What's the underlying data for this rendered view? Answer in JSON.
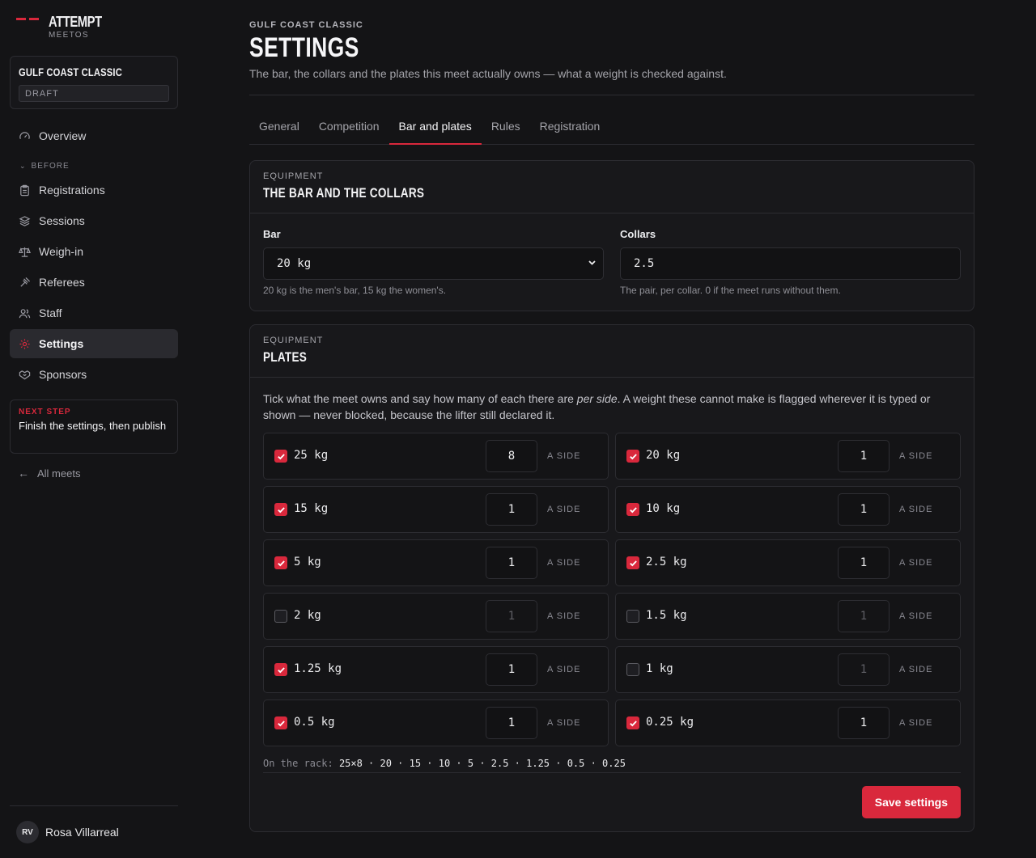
{
  "brand": {
    "name": "ATTEMPT",
    "sub": "MEETOS",
    "accent": "#d9283c"
  },
  "meet_card": {
    "title": "GULF COAST CLASSIC",
    "status": "DRAFT"
  },
  "nav": {
    "overview": "Overview",
    "section_before": "BEFORE",
    "items": [
      {
        "label": "Registrations",
        "icon": "clipboard-icon"
      },
      {
        "label": "Sessions",
        "icon": "layers-icon"
      },
      {
        "label": "Weigh-in",
        "icon": "scale-icon"
      },
      {
        "label": "Referees",
        "icon": "gavel-icon"
      },
      {
        "label": "Staff",
        "icon": "users-icon"
      },
      {
        "label": "Settings",
        "icon": "gear-icon",
        "active": true
      },
      {
        "label": "Sponsors",
        "icon": "handshake-icon"
      }
    ]
  },
  "next_step": {
    "label": "NEXT STEP",
    "text": "Finish the settings, then publish"
  },
  "all_meets": "All meets",
  "user": {
    "initials": "RV",
    "name": "Rosa Villarreal"
  },
  "header": {
    "crumb": "GULF COAST CLASSIC",
    "title": "SETTINGS",
    "description": "The bar, the collars and the plates this meet actually owns — what a weight is checked against."
  },
  "tabs": [
    {
      "label": "General"
    },
    {
      "label": "Competition"
    },
    {
      "label": "Bar and plates",
      "active": true
    },
    {
      "label": "Rules"
    },
    {
      "label": "Registration"
    }
  ],
  "bar_card": {
    "eyebrow": "EQUIPMENT",
    "title": "THE BAR AND THE COLLARS",
    "bar_label": "Bar",
    "bar_value": "20 kg",
    "bar_hint": "20 kg is the men's bar, 15 kg the women's.",
    "collars_label": "Collars",
    "collars_value": "2.5",
    "collars_hint": "The pair, per collar. 0 if the meet runs without them."
  },
  "plates_card": {
    "eyebrow": "EQUIPMENT",
    "title": "PLATES",
    "intro_pre": "Tick what the meet owns and say how many of each there are ",
    "intro_em": "per side",
    "intro_post": ". A weight these cannot make is flagged wherever it is typed or shown — never blocked, because the lifter still declared it.",
    "aside_label": "A SIDE",
    "plates": [
      {
        "label": "25 kg",
        "checked": true,
        "qty": "8"
      },
      {
        "label": "20 kg",
        "checked": true,
        "qty": "1"
      },
      {
        "label": "15 kg",
        "checked": true,
        "qty": "1"
      },
      {
        "label": "10 kg",
        "checked": true,
        "qty": "1"
      },
      {
        "label": "5 kg",
        "checked": true,
        "qty": "1"
      },
      {
        "label": "2.5 kg",
        "checked": true,
        "qty": "1"
      },
      {
        "label": "2 kg",
        "checked": false,
        "qty": "1"
      },
      {
        "label": "1.5 kg",
        "checked": false,
        "qty": "1"
      },
      {
        "label": "1.25 kg",
        "checked": true,
        "qty": "1"
      },
      {
        "label": "1 kg",
        "checked": false,
        "qty": "1"
      },
      {
        "label": "0.5 kg",
        "checked": true,
        "qty": "1"
      },
      {
        "label": "0.25 kg",
        "checked": true,
        "qty": "1"
      }
    ],
    "rack_label": "On the rack:",
    "rack_value": "25×8 · 20 · 15 · 10 · 5 · 2.5 · 1.25 · 0.5 · 0.25",
    "save_label": "Save settings"
  }
}
